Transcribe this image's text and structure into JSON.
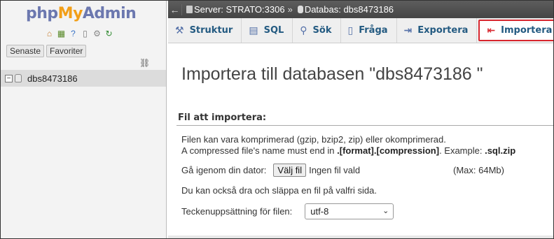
{
  "sidebar": {
    "logo": {
      "php": "php",
      "my": "My",
      "admin": "Admin"
    },
    "quick_icons": [
      "home-icon",
      "sql-icon",
      "help-icon",
      "docs-icon",
      "settings-icon",
      "reload-icon"
    ],
    "tabs": [
      {
        "label": "Senaste"
      },
      {
        "label": "Favoriter"
      }
    ],
    "link_icon": "link-icon",
    "tree": {
      "expand": "−",
      "db_name": "dbs8473186"
    }
  },
  "breadcrumb": {
    "back": "←",
    "server": "Server: STRATO:3306",
    "separator": "»",
    "database": "Databas: dbs8473186"
  },
  "menu": {
    "tabs": [
      {
        "label": "Struktur",
        "icon": "structure-icon"
      },
      {
        "label": "SQL",
        "icon": "sql-icon"
      },
      {
        "label": "Sök",
        "icon": "search-icon"
      },
      {
        "label": "Fråga",
        "icon": "query-icon"
      },
      {
        "label": "Exportera",
        "icon": "export-icon"
      },
      {
        "label": "Importera",
        "icon": "import-icon",
        "active": true
      }
    ]
  },
  "main": {
    "title": "Importera till databasen \"dbs8473186 \"",
    "section_title": "Fil att importera:",
    "compress_line1": "Filen kan vara komprimerad (gzip, bzip2, zip) eller okomprimerad.",
    "compress_line2_pre": "A compressed file's name must end in ",
    "compress_line2_bold": ".[format].[compression]",
    "compress_line2_mid": ". Example: ",
    "compress_line2_example": ".sql.zip",
    "browse_label": "Gå igenom din dator:",
    "choose_button": "Välj fil",
    "no_file": "Ingen fil vald",
    "max_size": "(Max: 64Mb)",
    "drag_note": "Du kan också dra och släppa en fil på valfri sida.",
    "charset_label": "Teckenuppsättning för filen:",
    "charset_value": "utf-8"
  },
  "colors": {
    "accent_highlight": "#d8262e",
    "link": "#235a81"
  }
}
